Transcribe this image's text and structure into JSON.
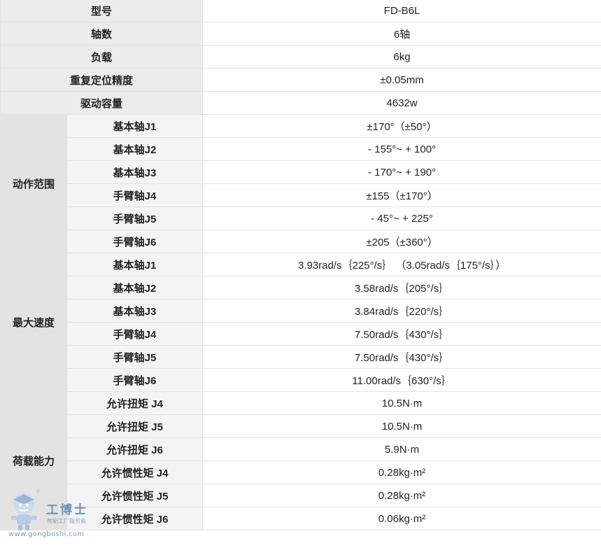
{
  "rows": [
    {
      "label": "型号",
      "value": "FD-B6L"
    },
    {
      "label": "轴数",
      "value": "6轴"
    },
    {
      "label": "负载",
      "value": "6kg"
    },
    {
      "label": "重复定位精度",
      "value": "±0.05mm"
    },
    {
      "label": "驱动容量",
      "value": "4632w"
    }
  ],
  "groups": [
    {
      "label": "动作范围",
      "rows": [
        {
          "label": "基本轴J1",
          "value": "±170°（±50°）"
        },
        {
          "label": "基本轴J2",
          "value": "- 155°~ + 100°"
        },
        {
          "label": "基本轴J3",
          "value": "- 170°~ + 190°"
        },
        {
          "label": "手臂轴J4",
          "value": "±155（±170°）"
        },
        {
          "label": "手臂轴J5",
          "value": "- 45°~ + 225°"
        },
        {
          "label": "手臂轴J6",
          "value": "±205（±360°）"
        }
      ]
    },
    {
      "label": "最大速度",
      "rows": [
        {
          "label": "基本轴J1",
          "value": "3.93rad/s｛225°/s｝ （3.05rad/s｛175°/s｝）"
        },
        {
          "label": "基本轴J2",
          "value": "3.58rad/s｛205°/s｝"
        },
        {
          "label": "基本轴J3",
          "value": "3.84rad/s｛220°/s｝"
        },
        {
          "label": "手臂轴J4",
          "value": "7.50rad/s｛430°/s｝"
        },
        {
          "label": "手臂轴J5",
          "value": "7.50rad/s｛430°/s｝"
        },
        {
          "label": "手臂轴J6",
          "value": "11.00rad/s｛630°/s｝"
        }
      ]
    },
    {
      "label": "荷载能力",
      "rows": [
        {
          "label": "允许扭矩 J4",
          "value": "10.5N·m"
        },
        {
          "label": "允许扭矩 J5",
          "value": "10.5N·m"
        },
        {
          "label": "允许扭矩 J6",
          "value": "5.9N·m"
        },
        {
          "label": "允许惯性矩 J4",
          "value": "0.28kg·m²"
        },
        {
          "label": "允许惯性矩 J5",
          "value": "0.28kg·m²"
        },
        {
          "label": "允许惯性矩 J6",
          "value": "0.06kg·m²"
        }
      ]
    }
  ],
  "watermark": {
    "brand": "工博士",
    "subtitle": "智能工厂服务商",
    "url": "www.gongboshi.com",
    "registered": "®"
  },
  "colors": {
    "label_bg": "#ececec",
    "group_bg": "#e3e3e3",
    "sub_bg": "#f4f4f4",
    "border": "#e3e3e3",
    "watermark_blue": "#5f87b2"
  }
}
